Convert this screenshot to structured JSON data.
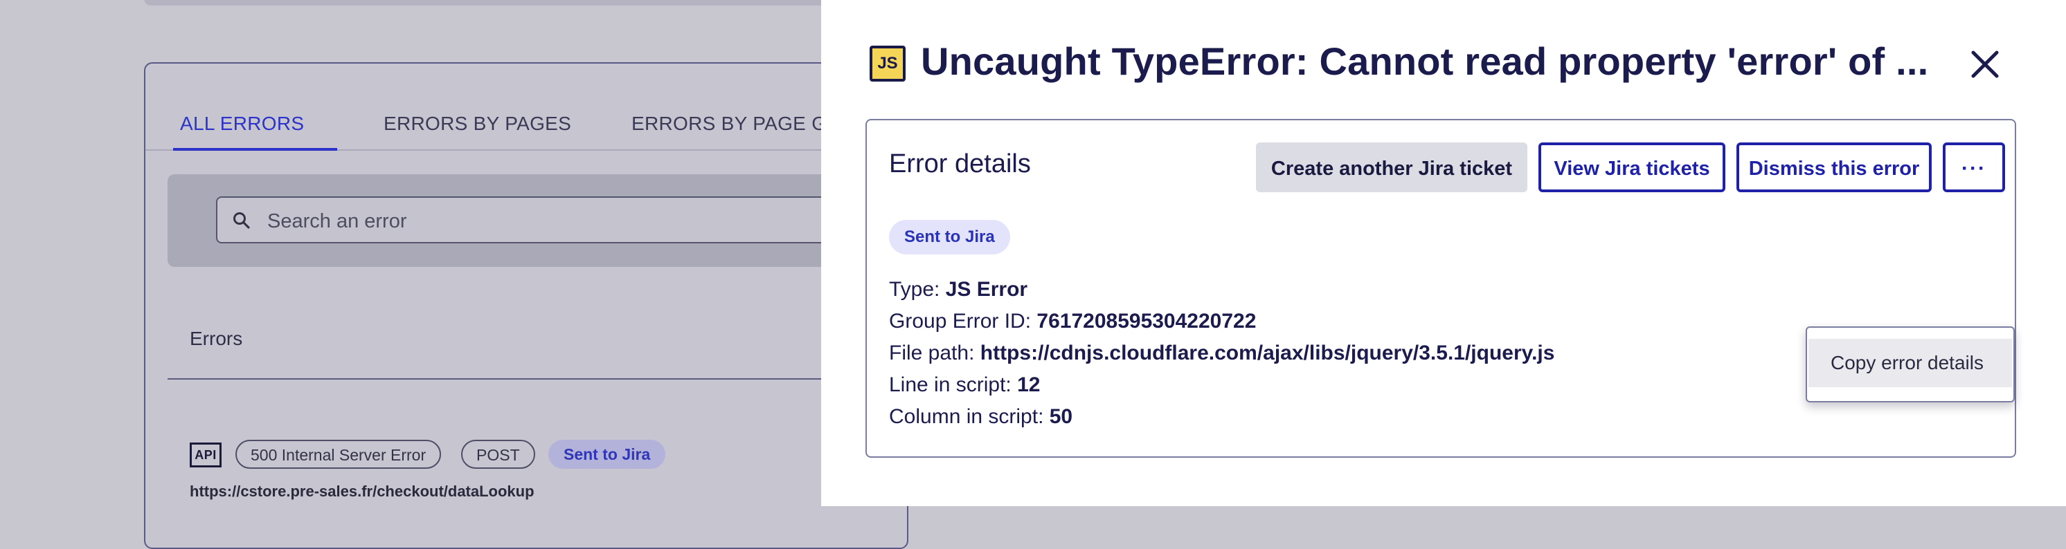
{
  "background": {
    "tabs": [
      "ALL ERRORS",
      "ERRORS BY PAGES",
      "ERRORS BY PAGE GRO"
    ],
    "search": {
      "placeholder": "Search an error"
    },
    "errors_label": "Errors",
    "row": {
      "icon": "API",
      "pills": [
        "500 Internal Server Error",
        "POST"
      ],
      "badge": "Sent to Jira",
      "url": "https://cstore.pre-sales.fr/checkout/dataLookup"
    }
  },
  "drawer": {
    "icon_label": "JS",
    "title": "Uncaught TypeError: Cannot read property 'error' of ...",
    "panel": {
      "heading": "Error details",
      "buttons": {
        "create": "Create another Jira ticket",
        "view": "View Jira tickets",
        "dismiss": "Dismiss this error",
        "more": "···"
      },
      "badge": "Sent to Jira",
      "details": {
        "type_label": "Type:",
        "type_value": "JS Error",
        "group_label": "Group Error ID:",
        "group_value": "7617208595304220722",
        "path_label": "File path:",
        "path_value": "https://cdnjs.cloudflare.com/ajax/libs/jquery/3.5.1/jquery.js",
        "line_label": "Line in script:",
        "line_value": "12",
        "column_label": "Column in script:",
        "column_value": "50"
      }
    },
    "menu": {
      "items": [
        "Copy error details"
      ]
    }
  },
  "colors": {
    "overlay": "#c8c6ce",
    "accent": "#1f22a8",
    "text": "#1c1b4d",
    "js_icon": "#f5d557"
  },
  "icons": [
    "js-file-icon",
    "close-icon",
    "search-icon",
    "api-icon",
    "more-icon"
  ]
}
